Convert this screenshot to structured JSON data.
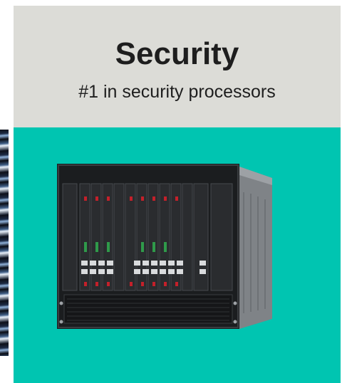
{
  "card": {
    "title": "Security",
    "subtitle": "#1 in security processors",
    "image_subject": "server chassis"
  },
  "colors": {
    "header_bg": "#dcdcd7",
    "body_bg": "#00c5b1",
    "text": "#1e1e1e"
  }
}
